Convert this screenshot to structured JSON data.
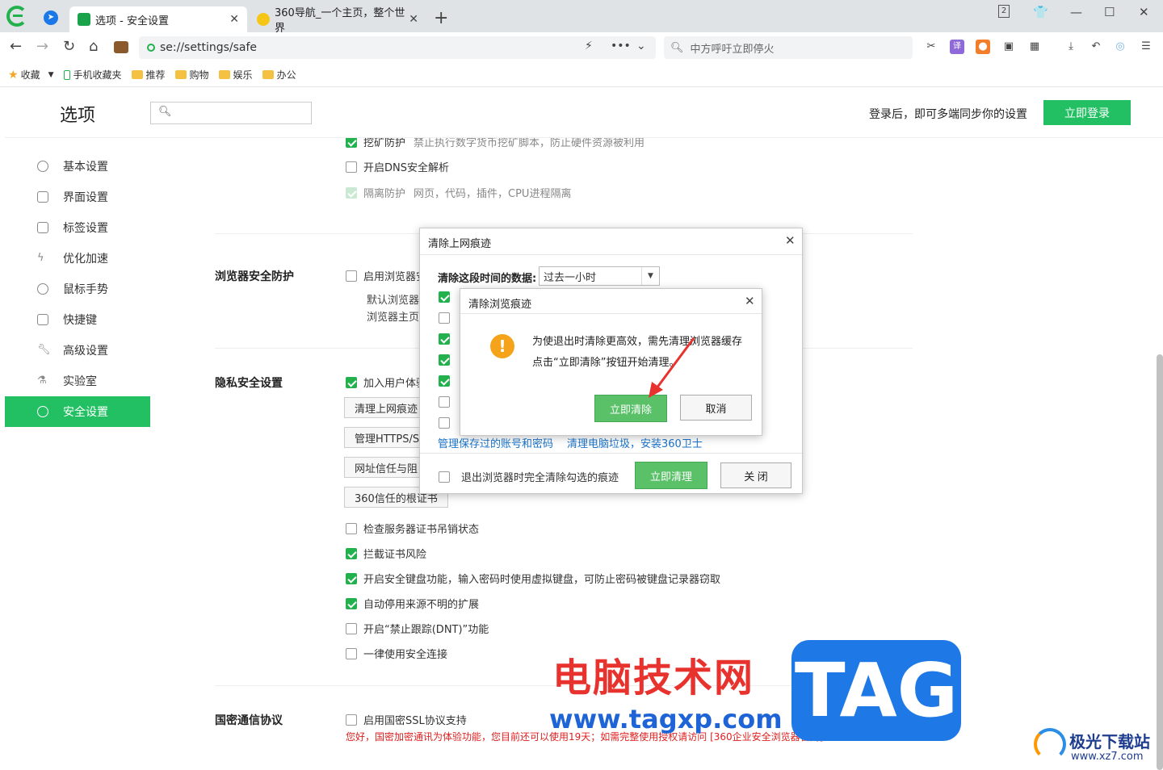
{
  "browser": {
    "tabs": [
      {
        "label": "选项 - 安全设置",
        "active": true
      },
      {
        "label": "360导航_一个主页，整个世界",
        "active": false
      }
    ],
    "window_badge": "2",
    "address": "se://settings/safe",
    "search_placeholder": "中方呼吁立即停火",
    "bookmarks": [
      "收藏",
      "手机收藏夹",
      "推荐",
      "购物",
      "娱乐",
      "办公"
    ]
  },
  "header": {
    "title": "选项",
    "search_placeholder": "",
    "sync_text": "登录后，即可多端同步你的设置",
    "login_label": "立即登录"
  },
  "sidebar": {
    "items": [
      {
        "label": "基本设置",
        "icon": "gear-icon"
      },
      {
        "label": "界面设置",
        "icon": "window-icon"
      },
      {
        "label": "标签设置",
        "icon": "tab-icon"
      },
      {
        "label": "优化加速",
        "icon": "lightning-icon"
      },
      {
        "label": "鼠标手势",
        "icon": "mouse-icon"
      },
      {
        "label": "快捷键",
        "icon": "keyboard-icon"
      },
      {
        "label": "高级设置",
        "icon": "wrench-icon"
      },
      {
        "label": "实验室",
        "icon": "flask-icon"
      },
      {
        "label": "安全设置",
        "icon": "shield-icon",
        "active": true
      }
    ]
  },
  "content": {
    "top_options": [
      {
        "label": "挖矿防护",
        "hint": "禁止执行数字货币挖矿脚本，防止硬件资源被利用",
        "checked": true
      },
      {
        "label": "开启DNS安全解析",
        "hint": "",
        "checked": false
      },
      {
        "label": "隔离防护",
        "hint": "网页，代码，插件，CPU进程隔离",
        "checked": true,
        "disabled": true
      }
    ],
    "browser_security": {
      "label": "浏览器安全防护",
      "option": "启用浏览器安",
      "sub1": "默认浏览器",
      "sub2": "浏览器主页"
    },
    "privacy": {
      "label": "隐私安全设置",
      "option": "加入用户体验",
      "buttons": [
        "清理上网痕迹",
        "管理HTTPS/S",
        "网址信任与阻",
        "360信任的根证书"
      ],
      "options": [
        {
          "label": "检查服务器证书吊销状态",
          "checked": false
        },
        {
          "label": "拦截证书风险",
          "checked": true
        },
        {
          "label": "开启安全键盘功能，输入密码时使用虚拟键盘，可防止密码被键盘记录器窃取",
          "checked": true
        },
        {
          "label": "自动停用来源不明的扩展",
          "checked": true
        },
        {
          "label": "开启“禁止跟踪(DNT)”功能",
          "checked": false
        },
        {
          "label": "一律使用安全连接",
          "checked": false
        }
      ]
    },
    "guomi": {
      "label": "国密通信协议",
      "option": "启用国密SSL协议支持",
      "note": "您好，国密加密通讯为体验功能，您目前还可以使用19天；如需完整使用授权请访问 [360企业安全浏览器官网]"
    }
  },
  "dialog_clear": {
    "title": "清除上网痕迹",
    "range_label": "清除这段时间的数据:",
    "range_value": "过去一小时",
    "checks": [
      true,
      false,
      true,
      true,
      true,
      false,
      false
    ],
    "link_accounts": "管理保存过的账号和密码",
    "link_cleanup": "清理电脑垃圾，安装360卫士",
    "exit_option": "退出浏览器时完全清除勾选的痕迹",
    "clean_label": "立即清理",
    "close_label": "关 闭"
  },
  "dialog_confirm": {
    "title": "清除浏览痕迹",
    "line1": "为使退出时清除更高效，需先清理浏览器缓存",
    "line2": "点击“立即清除”按钮开始清理。",
    "confirm_label": "立即清除",
    "cancel_label": "取消"
  },
  "watermark": {
    "cn": "电脑技术网",
    "url": "www.tagxp.com",
    "tag": "TAG",
    "xz": "极光下载站",
    "xz_url": "www.xz7.com"
  },
  "colors": {
    "accent": "#23c063",
    "link": "#1a73c9",
    "warning": "#f4a31a",
    "note": "#e02020"
  }
}
